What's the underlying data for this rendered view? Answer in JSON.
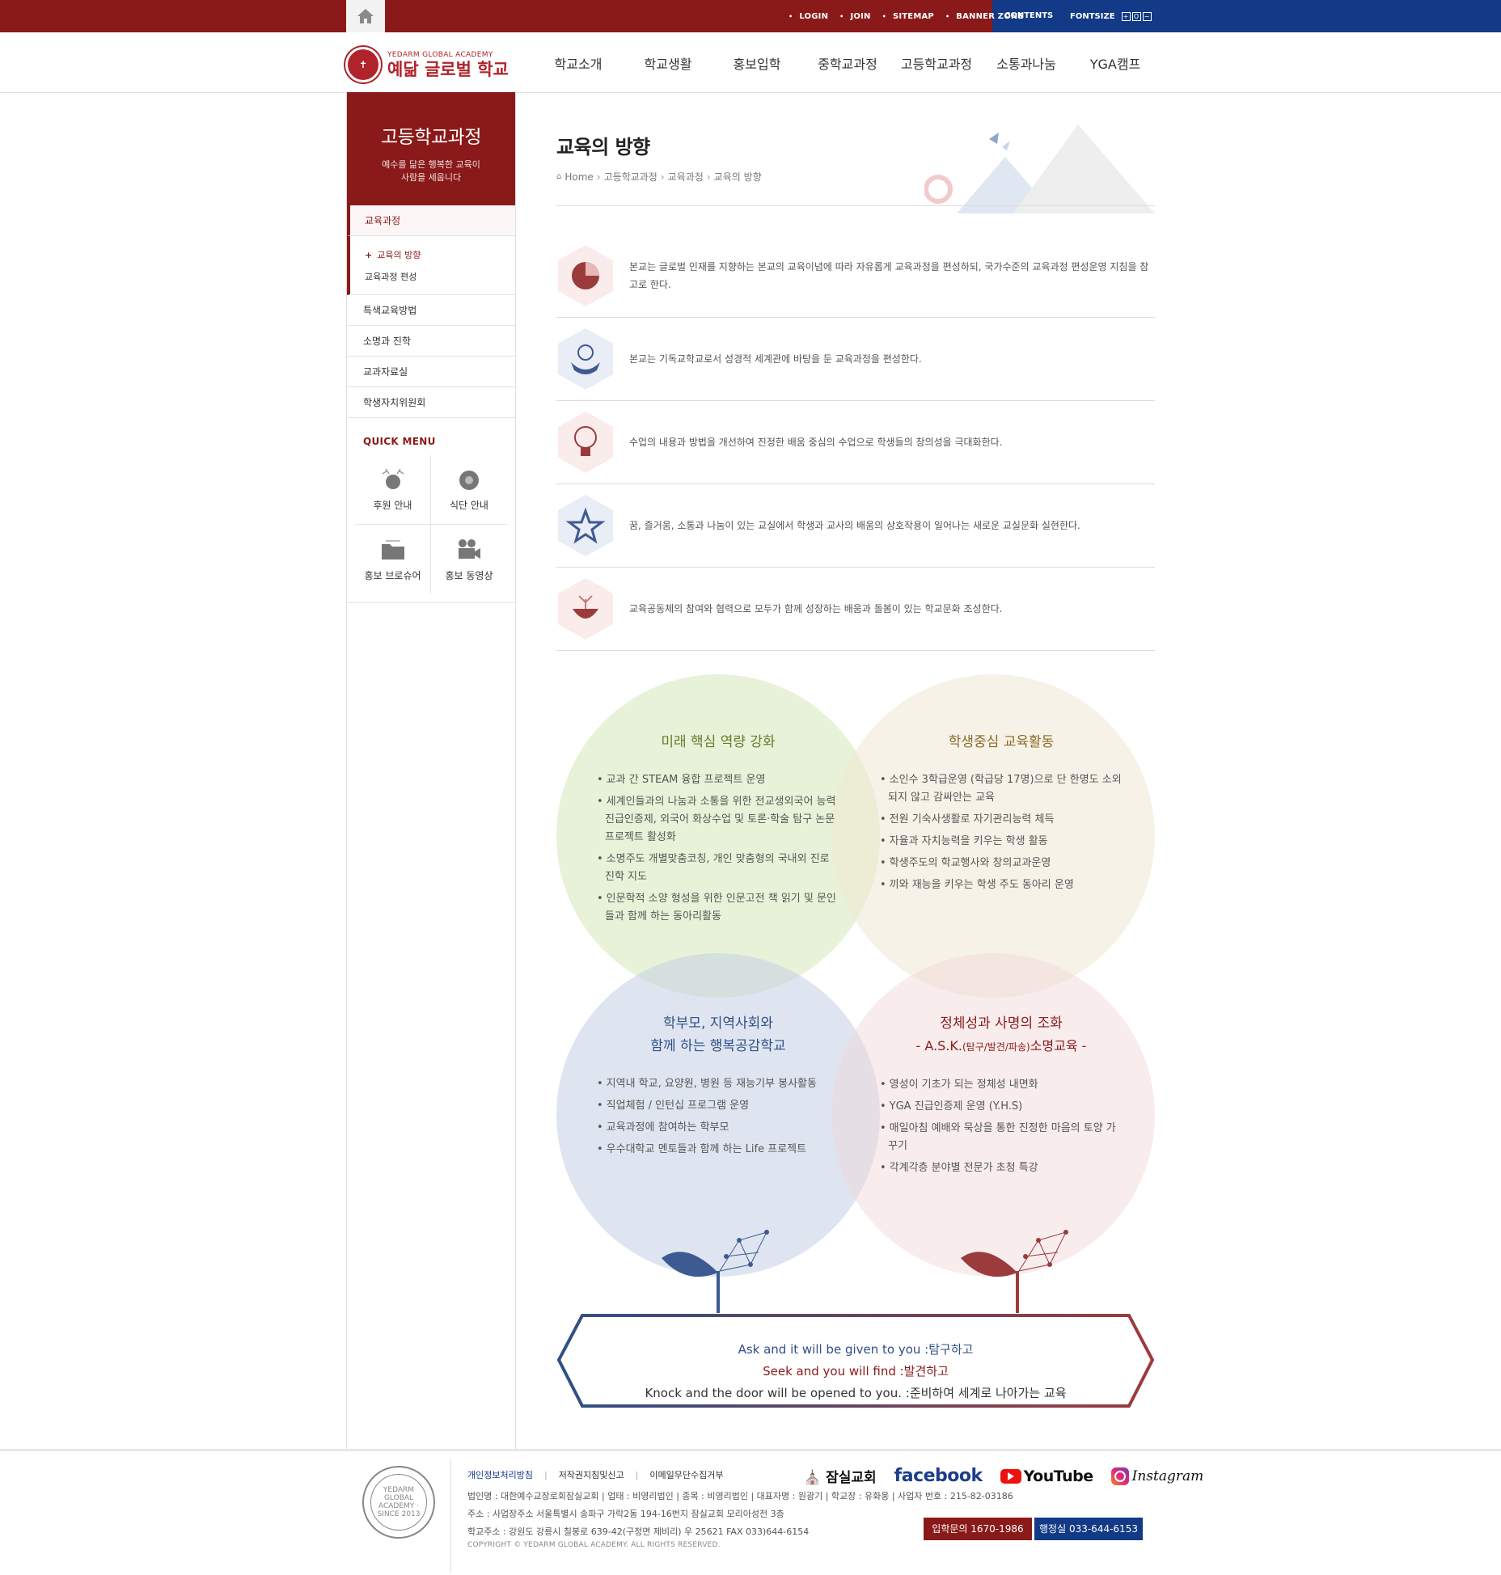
{
  "topbar": {
    "util_links": [
      "LOGIN",
      "JOIN",
      "SITEMAP",
      "BANNER ZONE"
    ],
    "contents": "CONTENTS",
    "fontsize": "FONTSIZE",
    "fontsize_controls": [
      "+",
      "O",
      "−"
    ],
    "colors": {
      "brand_red": "#8a1a1a",
      "brand_blue": "#123a86"
    }
  },
  "header": {
    "logo_en": "YEDARM GLOBAL ACADEMY",
    "logo_ko": "예닮 글로벌 학교",
    "gnb": [
      "학교소개",
      "학교생활",
      "홍보입학",
      "중학교과정",
      "고등학교과정",
      "소통과나눔",
      "YGA캠프"
    ]
  },
  "sidebar": {
    "title": "고등학교과정",
    "subtitle_1": "예수를 닮은 행복한 교육이",
    "subtitle_2": "사람을 세웁니다",
    "items": [
      {
        "label": "교육과정",
        "sub": [
          "교육의 방향",
          "교육과정 편성"
        ]
      },
      {
        "label": "특색교육방법"
      },
      {
        "label": "소명과 진학"
      },
      {
        "label": "교과자료실"
      },
      {
        "label": "학생자치위원회"
      }
    ],
    "quick_menu_title": "QUICK MENU",
    "quick_menu": [
      "후원 안내",
      "식단 안내",
      "홍보 브로슈어",
      "홍보 동영상"
    ]
  },
  "content": {
    "title": "교육의 방향",
    "breadcrumb": [
      "Home",
      "고등학교과정",
      "교육과정",
      "교육의 방향"
    ],
    "directions": [
      "본교는 글로벌 인재를 지향하는 본교의 교육이념에 따라 자유롭게 교육과정을 편성하되, 국가수준의 교육과정 편성운영 지침을 참고로 한다.",
      "본교는 기독교학교로서 성경적 세계관에 바탕을 둔 교육과정을 편성한다.",
      "수업의 내용과 방법을 개선하여 진정한 배움 중심의 수업으로 학생들의 창의성을 극대화한다.",
      "꿈, 즐거움, 소통과 나눔이 있는 교실에서 학생과 교사의 배움의 상호작용이 일어나는 새로운 교실문화 실현한다.",
      "교육공동체의 참여와 협력으로 모두가 함께 성장하는 배움과 돌봄이 있는 학교문화 조성한다."
    ],
    "quadrants": [
      {
        "title": "미래 핵심 역량 강화",
        "items": [
          "교과 간 STEAM 융합 프로젝트 운영",
          "세계인들과의 나눔과 소통을 위한 전교생외국어 능력 진급인증제, 외국어 화상수업 및 토론·학술 탐구 논문 프로젝트 활성화",
          "소명주도 개별맞춤코칭, 개인 맞춤형의 국내외 진로 진학 지도",
          "인문학적 소양 형성을 위한 인문고전 책 읽기 및 문인들과 함께 하는 동아리활동"
        ]
      },
      {
        "title": "학생중심 교육활동",
        "items": [
          "소인수 3학급운영 (학급당 17명)으로 단 한명도 소외되지 않고 감싸안는 교육",
          "전원 기숙사생활로 자기관리능력 체득",
          "자율과 자치능력을 키우는 학생 활동",
          "학생주도의 학교행사와 창의교과운영",
          "끼와 재능을 키우는 학생 주도 동아리 운영"
        ]
      },
      {
        "title_1": "학부모, 지역사회와",
        "title_2": "함께 하는 행복공감학교",
        "items": [
          "지역내 학교, 요양원, 병원 등 재능기부 봉사활동",
          "직업체험 / 인턴십 프로그램 운영",
          "교육과정에 참여하는 학부모",
          "우수대학교 멘토들과 함께 하는 Life 프로젝트"
        ]
      },
      {
        "title_1": "정체성과 사명의 조화",
        "title_2a": "- A.S.K.",
        "title_2b": "(탐구/발견/파송)",
        "title_2c": "소명교육 -",
        "items": [
          "영성이 기초가 되는 정체성 내면화",
          "YGA 진급인증제 운영 (Y.H.S)",
          "매일아침 예배와 묵상을 통한 진정한 마음의 토양 가꾸기",
          "각계각층 분야별 전문가 초청 특강"
        ]
      }
    ],
    "motto": [
      "Ask and it will be given to you :탐구하고",
      "Seek and you will find :발견하고",
      "Knock and the door will be opened to you. :준비하여 세계로 나아가는 교육"
    ]
  },
  "footer": {
    "logo_text": "YEDARM GLOBAL ACADEMY · SINCE 2013",
    "links": [
      "개인정보처리방침",
      "저작권지침및신고",
      "이메일무단수집거부"
    ],
    "line1": "법인명 : 대한예수교장로회잠실교회   |   업태 : 비영리법인   |   종목 : 비영리법인   |   대표자명 : 원광기   |   학교장 : 유화웅   |   사업자 번호 : 215-82-03186",
    "line2": "주소 : 사업장주소 서울특별시 송파구 가락2동 194-16번지 잠실교회 모리아성전 3층",
    "line3": "학교주소 : 강원도 강릉시 칠봉로 639-42(구정면 제비리) 우 25621 FAX 033)644-6154",
    "copyright": "COPYRIGHT © YEDARM GLOBAL ACADEMY. ALL RIGHTS RESERVED.",
    "sns": [
      "잠실교회",
      "facebook",
      "YouTube",
      "Instagram"
    ],
    "btn_admission": "입학문의 1670-1986",
    "btn_office": "행정실 033-644-6153"
  }
}
